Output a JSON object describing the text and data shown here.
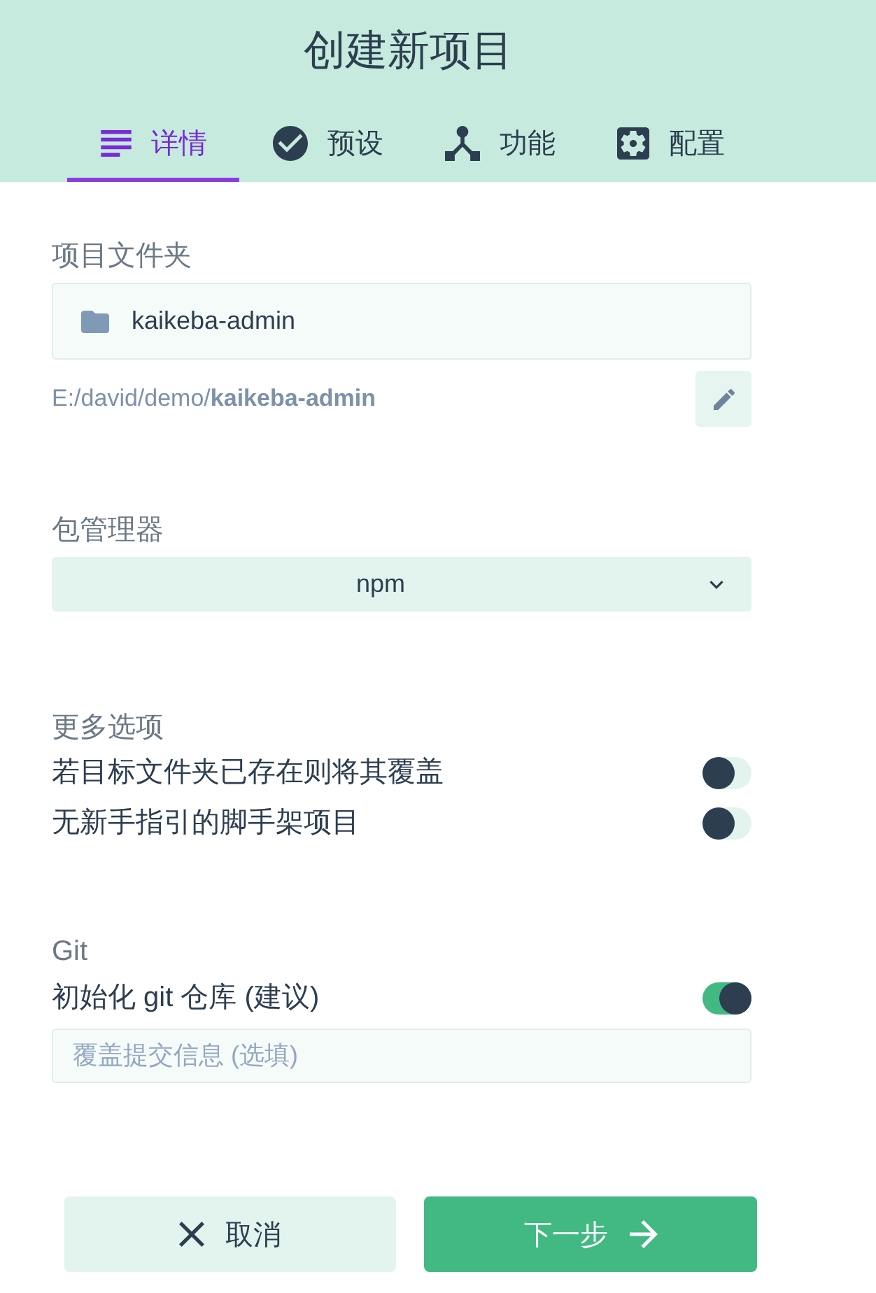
{
  "header": {
    "title": "创建新项目"
  },
  "tabs": [
    {
      "label": "详情",
      "selected": true
    },
    {
      "label": "预设",
      "selected": false
    },
    {
      "label": "功能",
      "selected": false
    },
    {
      "label": "配置",
      "selected": false
    }
  ],
  "folder": {
    "label": "项目文件夹",
    "value": "kaikeba-admin",
    "path": "E:/david/demo/**kaikeba-admin**"
  },
  "package_manager": {
    "label": "包管理器",
    "value": "npm"
  },
  "more_options": {
    "label": "更多选项",
    "toggles": [
      {
        "label": "若目标文件夹已存在则将其覆盖",
        "on": false
      },
      {
        "label": "无新手指引的脚手架项目",
        "on": false
      }
    ]
  },
  "git": {
    "label": "Git",
    "toggles": [
      {
        "label": "初始化 git 仓库 (建议)",
        "on": true
      }
    ],
    "commit_message": {
      "placeholder": "覆盖提交信息 (选填)"
    }
  },
  "buttons": [
    {
      "label": "取消",
      "kind": "cancel"
    },
    {
      "label": "下一步",
      "kind": "next"
    }
  ]
}
